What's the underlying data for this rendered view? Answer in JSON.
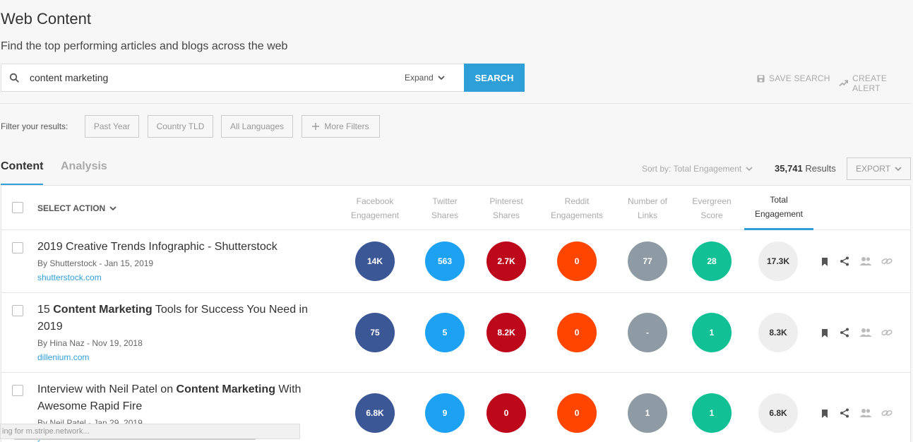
{
  "header": {
    "title": "Web Content",
    "subtitle": "Find the top performing articles and blogs across the web"
  },
  "search": {
    "value": "content marketing",
    "expand_label": "Expand",
    "button_label": "SEARCH",
    "save_search_label": "SAVE SEARCH",
    "create_alert_label": "CREATE ALERT"
  },
  "filters": {
    "label": "Filter your results:",
    "items": [
      "Past Year",
      "Country TLD",
      "All Languages"
    ],
    "more_label": "More Filters"
  },
  "tabs": {
    "content": "Content",
    "analysis": "Analysis"
  },
  "toolbar": {
    "sort_label": "Sort by: Total Engagement",
    "results_count": "35,741",
    "results_label": "Results",
    "export_label": "EXPORT"
  },
  "table": {
    "select_action_label": "SELECT ACTION",
    "columns": [
      {
        "line1": "Facebook",
        "line2": "Engagement"
      },
      {
        "line1": "Twitter",
        "line2": "Shares"
      },
      {
        "line1": "Pinterest",
        "line2": "Shares"
      },
      {
        "line1": "Reddit",
        "line2": "Engagements"
      },
      {
        "line1": "Number of",
        "line2": "Links"
      },
      {
        "line1": "Evergreen",
        "line2": "Score"
      },
      {
        "line1": "Total",
        "line2": "Engagement"
      }
    ],
    "rows": [
      {
        "title_parts": [
          "2019 Creative Trends Infographic - Shutterstock"
        ],
        "meta": "By Shutterstock - Jan 15, 2019",
        "domain": "shutterstock.com",
        "facebook": "14K",
        "twitter": "563",
        "pinterest": "2.7K",
        "reddit": "0",
        "links": "77",
        "evergreen": "28",
        "total": "17.3K"
      },
      {
        "title_parts": [
          "15 ",
          "Content Marketing",
          " Tools for Success You Need in 2019"
        ],
        "meta": "By Hina Naz - Nov 19, 2018",
        "domain": "dillenium.com",
        "facebook": "75",
        "twitter": "5",
        "pinterest": "8.2K",
        "reddit": "0",
        "links": "-",
        "evergreen": "1",
        "total": "8.3K"
      },
      {
        "title_parts": [
          "Interview with Neil Patel on ",
          "Content Marketing",
          " With Awesome Rapid Fire"
        ],
        "meta": "By Neil Patel - Jan 29, 2019",
        "domain": "youtube.com",
        "facebook": "6.8K",
        "twitter": "9",
        "pinterest": "0",
        "reddit": "0",
        "links": "1",
        "evergreen": "1",
        "total": "6.8K"
      }
    ]
  },
  "status_bar": {
    "text": "ing for m.stripe.network..."
  },
  "icons": {
    "search": "search-icon",
    "chevron": "chevron-down-icon",
    "save": "floppy-disk-icon",
    "alert": "trend-up-icon",
    "plus": "plus-icon",
    "bookmark": "bookmark-icon",
    "share": "share-icon",
    "people": "people-icon",
    "link": "link-icon"
  }
}
